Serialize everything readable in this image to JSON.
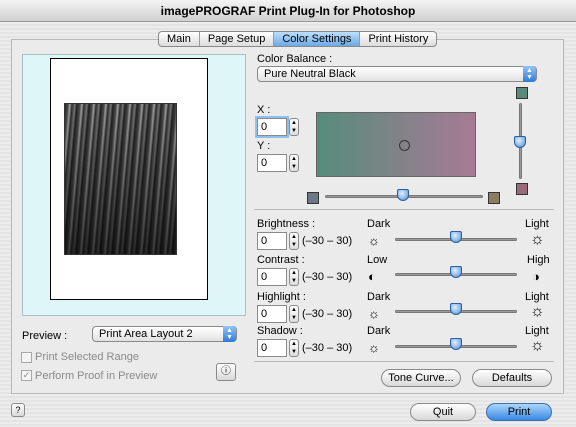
{
  "window": {
    "title": "imagePROGRAF Print Plug-In for Photoshop"
  },
  "tabs": [
    {
      "label": "Main"
    },
    {
      "label": "Page Setup"
    },
    {
      "label": "Color Settings",
      "active": true
    },
    {
      "label": "Print History"
    }
  ],
  "color_balance": {
    "label": "Color Balance :",
    "selected": "Pure Neutral Black",
    "x_label": "X :",
    "x_value": "0",
    "y_label": "Y :",
    "y_value": "0"
  },
  "adjustments": [
    {
      "label": "Brightness :",
      "value": "0",
      "range": "(–30 – 30)",
      "left": "Dark",
      "right": "Light",
      "left_icon": "sun-small-icon",
      "right_icon": "sun-large-icon"
    },
    {
      "label": "Contrast :",
      "value": "0",
      "range": "(–30 – 30)",
      "left": "Low",
      "right": "High",
      "left_icon": "contrast-low-icon",
      "right_icon": "contrast-high-icon"
    },
    {
      "label": "Highlight :",
      "value": "0",
      "range": "(–30 – 30)",
      "left": "Dark",
      "right": "Light",
      "left_icon": "sun-small-icon",
      "right_icon": "sun-large-icon"
    },
    {
      "label": "Shadow :",
      "value": "0",
      "range": "(–30 – 30)",
      "left": "Dark",
      "right": "Light",
      "left_icon": "sun-small-icon",
      "right_icon": "sun-large-icon"
    }
  ],
  "preview": {
    "label": "Preview :",
    "selected": "Print Area Layout 2",
    "print_selected_range": "Print Selected Range",
    "print_selected_range_checked": false,
    "perform_proof": "Perform Proof in Preview",
    "perform_proof_checked": true
  },
  "buttons": {
    "tone_curve": "Tone Curve...",
    "defaults": "Defaults",
    "quit": "Quit",
    "print": "Print",
    "help": "?"
  },
  "colors": {
    "accent": "#3a89e2",
    "preview_bg": "#dff6f8",
    "swatch_gray_blue": "#6b7888",
    "swatch_olive": "#8a7d62",
    "swatch_green": "#5a8a78",
    "swatch_mauve": "#9a6a7a"
  }
}
